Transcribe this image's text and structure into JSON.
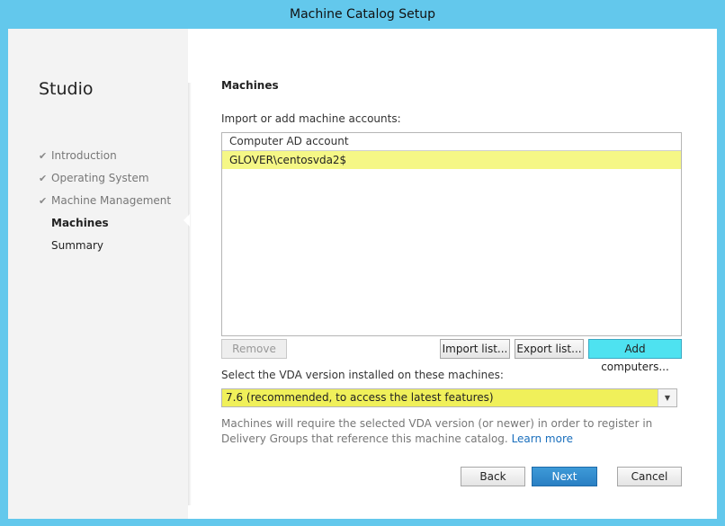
{
  "window": {
    "title": "Machine Catalog Setup"
  },
  "sidebar": {
    "title": "Studio",
    "steps": [
      {
        "label": "Introduction",
        "state": "completed"
      },
      {
        "label": "Operating System",
        "state": "completed"
      },
      {
        "label": "Machine Management",
        "state": "completed"
      },
      {
        "label": "Machines",
        "state": "current"
      },
      {
        "label": "Summary",
        "state": "pending"
      }
    ],
    "check_icon": "✔"
  },
  "main": {
    "heading": "Machines",
    "import_label": "Import or add machine accounts:",
    "list": {
      "column_header": "Computer AD account",
      "rows": [
        "GLOVER\\centosvda2$"
      ]
    },
    "buttons": {
      "remove": "Remove",
      "import_list": "Import list...",
      "export_list": "Export list...",
      "add_computers": "Add computers..."
    },
    "vda_label": "Select the VDA version installed on these machines:",
    "vda_select": {
      "value": "7.6 (recommended, to access the latest features)",
      "arrow": "▼"
    },
    "note": {
      "text": "Machines will require the selected VDA version (or newer) in order to register in Delivery Groups that reference this machine catalog.",
      "link": "Learn more"
    }
  },
  "footer": {
    "back": "Back",
    "next": "Next",
    "cancel": "Cancel"
  },
  "colors": {
    "frame": "#63c8ec",
    "highlight": "#f5f786",
    "select_bg": "#f0f05a",
    "add_button": "#4ee2f0",
    "next_button": "#2a7fc3",
    "link": "#1a6fbd"
  }
}
